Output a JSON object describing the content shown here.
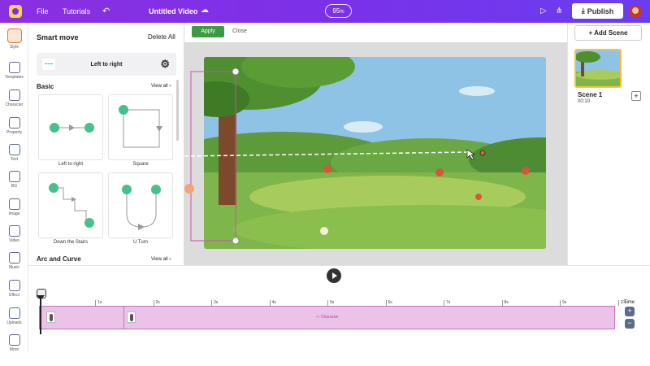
{
  "topbar": {
    "file": "File",
    "tutorials": "Tutorials",
    "undo": "↶",
    "title": "Untitled Video",
    "zoom_value": "95",
    "zoom_unit": "%",
    "publish": "Publish"
  },
  "rail": [
    {
      "label": "Style",
      "icon": "avatar-icon"
    },
    {
      "label": "Templates",
      "icon": "templates-icon"
    },
    {
      "label": "Character",
      "icon": "character-icon"
    },
    {
      "label": "Property",
      "icon": "property-icon"
    },
    {
      "label": "Text",
      "icon": "text-icon"
    },
    {
      "label": "BG",
      "icon": "bg-icon"
    },
    {
      "label": "Image",
      "icon": "image-icon"
    },
    {
      "label": "Video",
      "icon": "video-icon"
    },
    {
      "label": "Music",
      "icon": "music-icon"
    },
    {
      "label": "Effect",
      "icon": "effect-icon"
    },
    {
      "label": "Uploads",
      "icon": "uploads-icon"
    },
    {
      "label": "More",
      "icon": "more-icon"
    }
  ],
  "panel": {
    "title": "Smart move",
    "delete_all": "Delete All",
    "selected_move": "Left to right",
    "section_basic": "Basic",
    "view_all": "View all",
    "section_arc": "Arc and Curve",
    "cards": [
      {
        "label": "Left to right"
      },
      {
        "label": "Square"
      },
      {
        "label": "Down the Stairs"
      },
      {
        "label": "U Turn"
      }
    ]
  },
  "editor": {
    "apply": "Apply",
    "close": "Close"
  },
  "scenes": {
    "add_scene": "+ Add Scene",
    "scene_name": "Scene 1",
    "scene_duration": "00:10",
    "add": "+"
  },
  "timeline": {
    "ticks": [
      "1s",
      "2s",
      "3s",
      "4s",
      "5s",
      "6s",
      "7s",
      "8s",
      "9s",
      "10s"
    ],
    "track_label": "Character",
    "time_label": "Time",
    "zoom_in": "+",
    "zoom_out": "−"
  },
  "colors": {
    "brand": "#7b31e8",
    "apply": "#3c9a45",
    "track": "#ecc3e8",
    "accent_teal": "#46c08c"
  }
}
